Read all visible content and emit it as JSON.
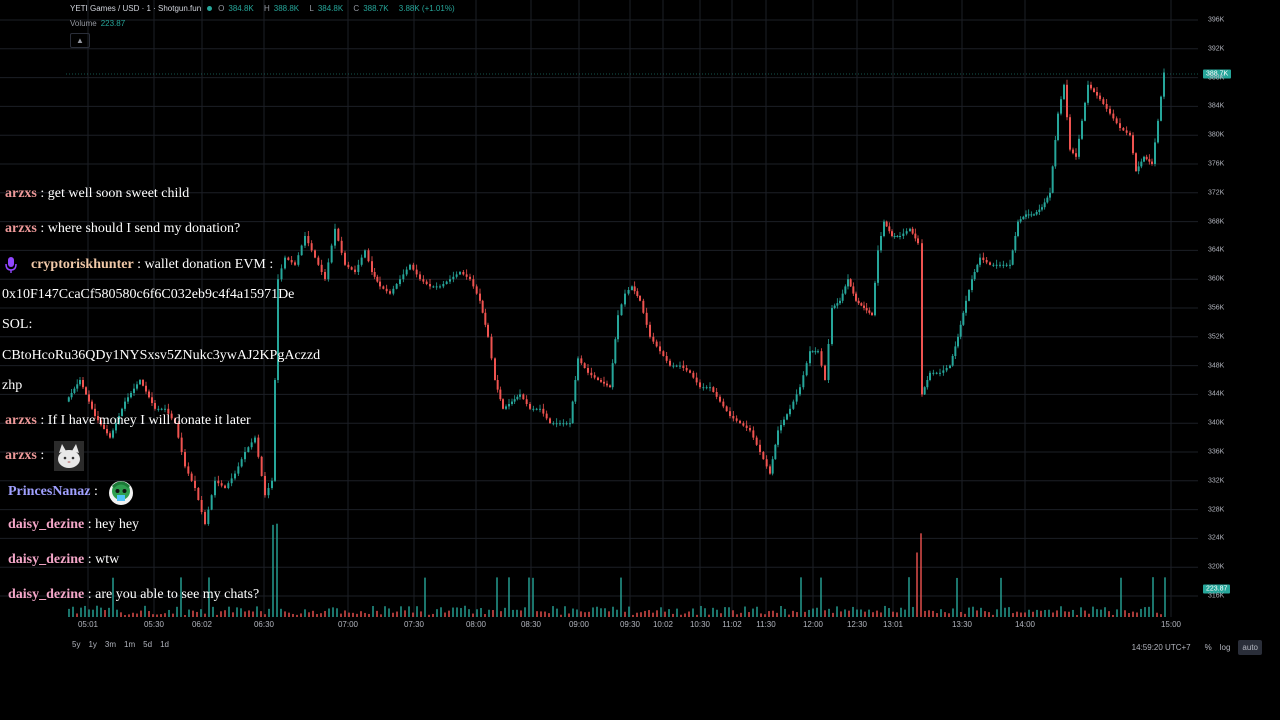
{
  "header": {
    "title": "YETI Games / USD · 1 · Shotgun.fun",
    "ohlc": [
      {
        "label": "O",
        "value": "384.8K"
      },
      {
        "label": "H",
        "value": "388.8K"
      },
      {
        "label": "L",
        "value": "384.8K"
      },
      {
        "label": "C",
        "value": "388.7K"
      }
    ],
    "change": "3.88K (+1.01%)",
    "volume_label": "Volume",
    "volume_value": "223.87",
    "collapse_icon": "chevron-up-icon"
  },
  "price_axis": [
    "396K",
    "392K",
    "388K",
    "384K",
    "380K",
    "376K",
    "372K",
    "368K",
    "364K",
    "360K",
    "356K",
    "352K",
    "348K",
    "344K",
    "340K",
    "336K",
    "332K",
    "328K",
    "324K",
    "320K",
    "316K"
  ],
  "price_tag": "388.7K",
  "volume_tag": "223.87",
  "time_axis": [
    "05:01",
    "05:30",
    "06:02",
    "06:30",
    "07:00",
    "07:30",
    "08:00",
    "08:30",
    "09:00",
    "09:30",
    "10:02",
    "10:30",
    "11:02",
    "11:30",
    "12:00",
    "12:30",
    "13:01",
    "13:30",
    "14:00",
    "15:00"
  ],
  "bottom": {
    "ranges": [
      "5y",
      "1y",
      "3m",
      "1m",
      "5d",
      "1d"
    ],
    "time": "14:59:20 UTC+7",
    "percent": "%",
    "log": "log",
    "auto": "auto"
  },
  "colors": {
    "up": "#26a69a",
    "down": "#ef5350",
    "background": "#000000",
    "grid": "#1c1f26"
  },
  "chat": [
    {
      "user": "arzxs",
      "user_color": "#ef9a9a",
      "text": ": get well soon sweet child"
    },
    {
      "user": "arzxs",
      "user_color": "#ef9a9a",
      "text": ": where should I send my donation?"
    },
    {
      "user": "cryptoriskhunter",
      "user_color": "#f0c8a8",
      "text": ": wallet donation EVM :",
      "icon": "microphone-icon"
    },
    {
      "raw": "0x10F147CcaCf580580c6f6C032eb9c4f4a15971De"
    },
    {
      "raw": "SOL:"
    },
    {
      "raw": "CBtoHcoRu36QDy1NYSxsv5ZNukc3ywAJ2KPgAczzd"
    },
    {
      "raw": "zhp"
    },
    {
      "user": "arzxs",
      "user_color": "#ef9a9a",
      "text": ": If I have money I will donate it later"
    },
    {
      "user": "arzxs",
      "user_color": "#ef9a9a",
      "text": ":",
      "emote": "cat-emote"
    },
    {
      "user": "PrincesNanaz",
      "user_color": "#a0a0ff",
      "text": ":",
      "emote": "frog-emote"
    },
    {
      "user": "daisy_dezine",
      "user_color": "#f4a6c8",
      "text": ": hey hey"
    },
    {
      "user": "daisy_dezine",
      "user_color": "#f4a6c8",
      "text": ": wtw"
    },
    {
      "user": "daisy_dezine",
      "user_color": "#f4a6c8",
      "text": ": are you able to see my chats?"
    }
  ]
}
